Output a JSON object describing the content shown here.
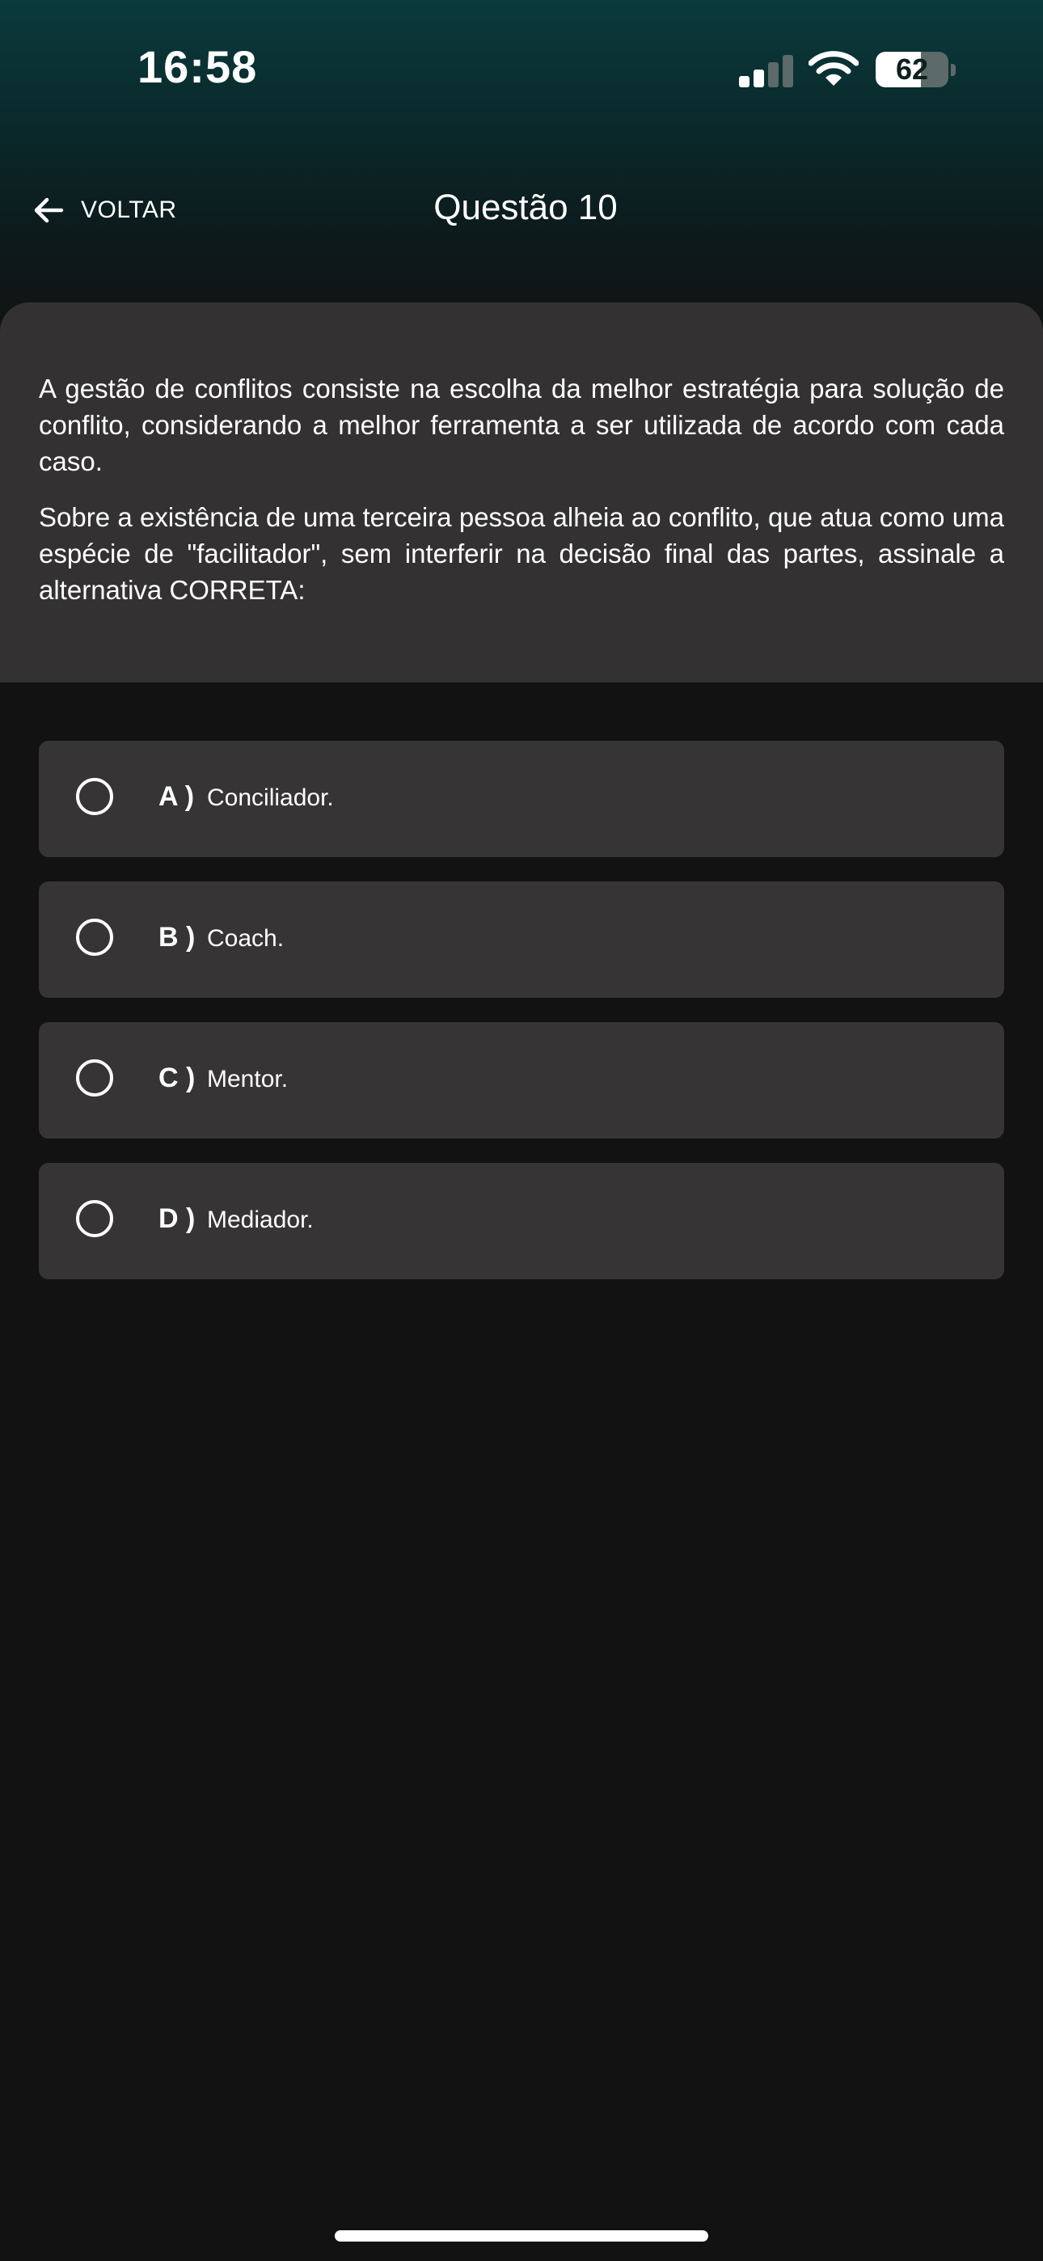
{
  "status_bar": {
    "time": "16:58",
    "battery_level": "62",
    "battery_fraction": 0.62,
    "signal_bars_active": 2,
    "signal_bars_total": 4,
    "icons": [
      "cellular-signal-icon",
      "wifi-icon",
      "battery-icon"
    ]
  },
  "header": {
    "back_label": "VOLTAR",
    "back_icon": "arrow-left-icon",
    "title": "Questão 10"
  },
  "question": {
    "paragraphs": [
      "A gestão de conflitos consiste na escolha da melhor estratégia para solução de conflito, considerando a melhor ferramenta a ser utilizada de acordo com cada caso.",
      "Sobre a existência de uma terceira pessoa alheia ao conflito, que atua como uma espécie de \"facilitador\", sem interferir na decisão final das partes, assinale a alternativa CORRETA:"
    ]
  },
  "options": [
    {
      "letter": "A )",
      "text": "Conciliador."
    },
    {
      "letter": "B )",
      "text": "Coach."
    },
    {
      "letter": "C )",
      "text": "Mentor."
    },
    {
      "letter": "D )",
      "text": "Mediador."
    }
  ],
  "colors": {
    "background": "#121212",
    "card": "#333132",
    "option_bg": "#363435",
    "header_teal": "#0b3a3c",
    "text": "#ffffff",
    "signal_active": "#ffffff",
    "signal_inactive": "#5c6a6a"
  }
}
